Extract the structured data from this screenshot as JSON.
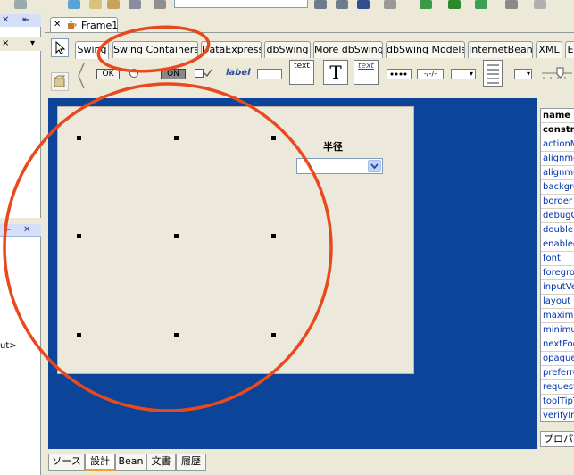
{
  "window": {
    "frame_tab": "Frame1",
    "left_panel_text": "ut>"
  },
  "palette": {
    "tabs": [
      {
        "label": "Swing",
        "active": true
      },
      {
        "label": "Swing Containers",
        "active": false
      },
      {
        "label": "DataExpress",
        "active": false
      },
      {
        "label": "dbSwing",
        "active": false
      },
      {
        "label": "More dbSwing",
        "active": false
      },
      {
        "label": "dbSwing Models",
        "active": false
      },
      {
        "label": "InternetBeans",
        "active": false
      },
      {
        "label": "XML",
        "active": false
      },
      {
        "label": "E",
        "active": false
      }
    ],
    "components": {
      "ok_button": "OK",
      "toggle_button": "ON",
      "label": "label",
      "text_area": "text",
      "text_pane": "T",
      "editor_pane": "text",
      "formatted_field": "-/-/-"
    }
  },
  "design": {
    "radius_label": "半径",
    "radius_combo_value": ""
  },
  "inspector": {
    "properties": [
      {
        "name": "name",
        "header": true
      },
      {
        "name": "constr",
        "header": true
      },
      {
        "name": "actionM"
      },
      {
        "name": "alignme"
      },
      {
        "name": "alignme"
      },
      {
        "name": "backgro"
      },
      {
        "name": "border"
      },
      {
        "name": "debugG"
      },
      {
        "name": "doubleE"
      },
      {
        "name": "enabled"
      },
      {
        "name": "font"
      },
      {
        "name": "foregro"
      },
      {
        "name": "inputVe"
      },
      {
        "name": "layout"
      },
      {
        "name": "maximu"
      },
      {
        "name": "minimur"
      },
      {
        "name": "nextFoc"
      },
      {
        "name": "opaque"
      },
      {
        "name": "preferre"
      },
      {
        "name": "request"
      },
      {
        "name": "toolTipT"
      },
      {
        "name": "verifyIn"
      }
    ],
    "tab_label": "プロパ"
  },
  "bottom_tabs": [
    {
      "label": "ソース",
      "active": false
    },
    {
      "label": "設計",
      "active": true
    },
    {
      "label": "Bean",
      "active": false
    },
    {
      "label": "文書",
      "active": false
    },
    {
      "label": "履歴",
      "active": false
    }
  ],
  "colors": {
    "canvas_blue": "#0b4499",
    "form_bg": "#ede8dc",
    "annotation": "#e8491d",
    "chrome": "#ece9d8"
  }
}
